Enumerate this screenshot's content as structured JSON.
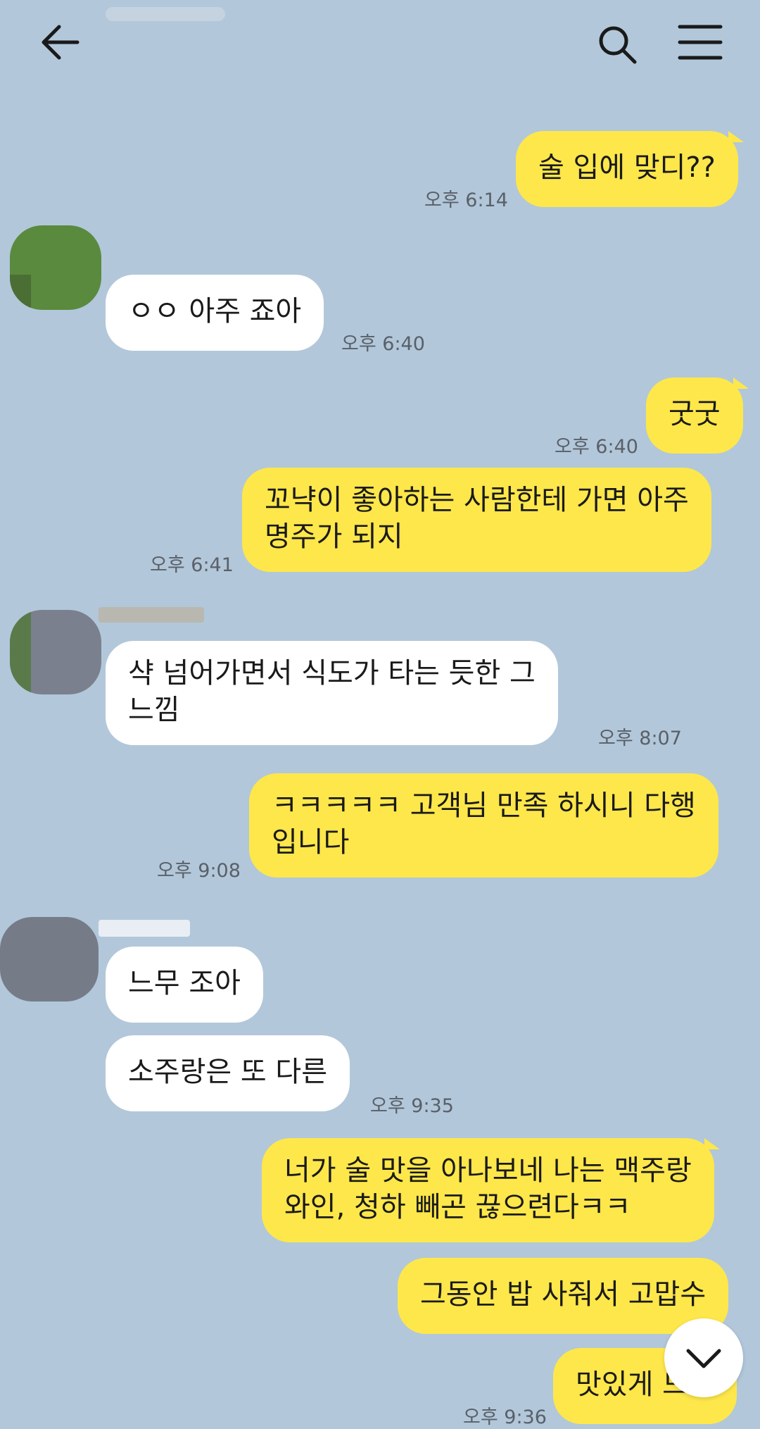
{
  "header": {
    "title": "",
    "back_icon": "back-arrow-icon",
    "search_icon": "search-icon",
    "menu_icon": "menu-icon"
  },
  "colors": {
    "background": "#b2c7da",
    "my_bubble": "#fee74a",
    "other_bubble": "#ffffff"
  },
  "messages": [
    {
      "sender": "me",
      "text": "술 입에 맞디??",
      "time": "오후 6:14"
    },
    {
      "sender": "other",
      "text": "ㅇㅇ 아주 죠아",
      "time": "오후 6:40"
    },
    {
      "sender": "me",
      "text": "굿굿",
      "time": "오후 6:40"
    },
    {
      "sender": "me",
      "lines": [
        "꼬냑이 좋아하는 사람한테 가면 아주",
        "명주가 되지"
      ],
      "time": "오후 6:41"
    },
    {
      "sender": "other",
      "lines": [
        "샥 넘어가면서 식도가 타는 듯한 그",
        "느낌"
      ],
      "time": "오후 8:07"
    },
    {
      "sender": "me",
      "lines": [
        "ㅋㅋㅋㅋㅋ 고객님 만족 하시니 다행",
        "입니다"
      ],
      "time": "오후 9:08"
    },
    {
      "sender": "other",
      "text": "느무 조아"
    },
    {
      "sender": "other",
      "text": "소주랑은 또 다른",
      "time": "오후 9:35"
    },
    {
      "sender": "me",
      "lines": [
        "너가 술 맛을 아나보네 나는 맥주랑",
        "와인, 청하 빼곤 끊으련다ㅋㅋ"
      ]
    },
    {
      "sender": "me",
      "text": "그동안 밥 사줘서 고맙수"
    },
    {
      "sender": "me",
      "text": "맛있게 드소",
      "time": "오후 9:36"
    }
  ],
  "scroll_down_icon": "chevron-down-icon"
}
